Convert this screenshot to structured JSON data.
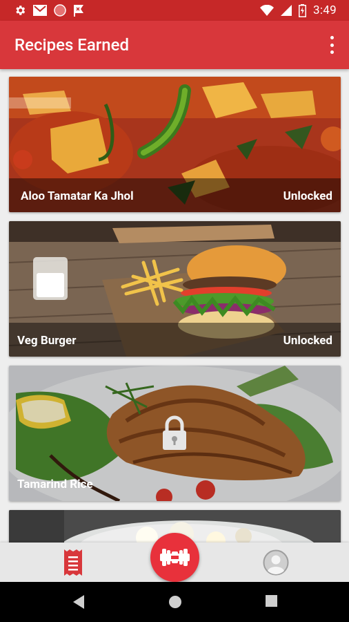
{
  "status_bar": {
    "time": "3:49",
    "left_icons": [
      "settings-icon",
      "gmail-icon",
      "circle-icon",
      "flag-icon"
    ],
    "right_icons": [
      "wifi-icon",
      "signal-icon",
      "battery-icon"
    ]
  },
  "app_bar": {
    "title": "Recipes Earned",
    "menu_icon": "more-vert-icon"
  },
  "recipes": [
    {
      "name": "Aloo Tamatar Ka Jhol",
      "status": "Unlocked",
      "locked": false
    },
    {
      "name": "Veg Burger",
      "status": "Unlocked",
      "locked": false
    },
    {
      "name": "Tamarind Rice",
      "status": "",
      "locked": true,
      "icon": "lock-icon"
    },
    {
      "name": "",
      "status": "",
      "locked": true
    }
  ],
  "bottom_nav": {
    "items": [
      {
        "name": "recipes",
        "icon": "receipt-icon",
        "active": true
      },
      {
        "name": "workout",
        "icon": "dumbbell-icon",
        "active": false
      },
      {
        "name": "profile",
        "icon": "profile-icon",
        "active": false
      }
    ]
  },
  "system_nav": [
    "back-icon",
    "home-icon",
    "recents-icon"
  ],
  "colors": {
    "status_bar": "#c62828",
    "app_bar": "#d8373b",
    "accent": "#e8313b",
    "bottom_nav": "#e7e7e7"
  }
}
